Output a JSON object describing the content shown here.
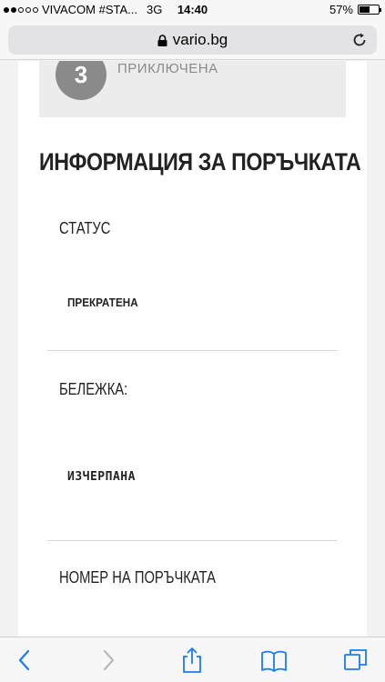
{
  "status_bar": {
    "carrier": "VIVACOM #STA...",
    "network": "3G",
    "time": "14:40",
    "battery_percent_label": "57%",
    "battery_level": 0.57
  },
  "browser": {
    "url": "vario.bg"
  },
  "order_step": {
    "number": "3",
    "label": "ПРИКЛЮЧЕНА"
  },
  "order_info": {
    "title": "ИНФОРМАЦИЯ ЗА ПОРЪЧКАТА",
    "status_label": "СТАТУС",
    "status_value": "ПРЕКРАТЕНА",
    "note_label": "БЕЛЕЖКА:",
    "note_value": "ИЗЧЕРПАНА",
    "order_number_label": "НОМЕР НА ПОРЪЧКАТА"
  },
  "colors": {
    "accent": "#1a7cf5",
    "disabled": "#b8b8bd"
  }
}
